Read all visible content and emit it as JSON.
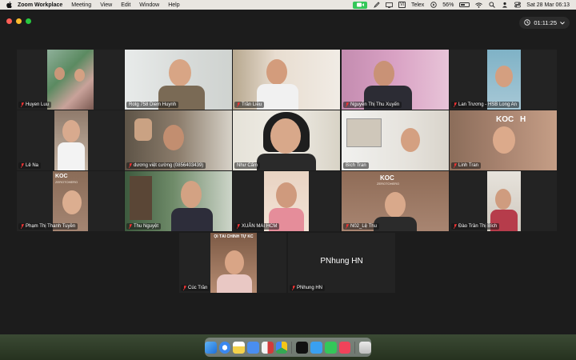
{
  "menubar": {
    "app_name": "Zoom Workplace",
    "items": [
      "Meeting",
      "View",
      "Edit",
      "Window",
      "Help"
    ],
    "input_source": "Telex",
    "battery": "56%",
    "battery_level": 0.56,
    "datetime": "Sat 28 Mar  06:13"
  },
  "meeting": {
    "timer": "01:11:25"
  },
  "participants": [
    {
      "name": "Huyen Luu"
    },
    {
      "name": "Rotg 758 Diem Huynh"
    },
    {
      "name": "Trần Liễu"
    },
    {
      "name": "Nguyễn Thị Thu Xuyến"
    },
    {
      "name": "Lan Trương  - HSB Long An"
    },
    {
      "name": "Lê Na"
    },
    {
      "name": "dương việt cường (0856403439)"
    },
    {
      "name": "Như Cẩm"
    },
    {
      "name": "Bích Tran"
    },
    {
      "name": "Linh Tran"
    },
    {
      "name": "Phạm Thị Thanh Tuyền"
    },
    {
      "name": "Thu Nguyệt"
    },
    {
      "name": "XUÂN MAI HCM"
    },
    {
      "name": "N02_Lệ Thu"
    },
    {
      "name": "Đào Trần Thị Bích"
    },
    {
      "name": "Cúc Trần"
    },
    {
      "name": "PNhung HN"
    }
  ],
  "tile_text": {
    "koc_title": "KOC",
    "koc_subtitle": "ZEROTOHERO",
    "koc_partial": "KOC",
    "koc_h": "H",
    "banner": "ỘI TÀI CHÍNH TỰ KC",
    "video_off_name": "PNhung HN"
  },
  "colors": {
    "active_speaker": "#3fd15a",
    "menubar_bg": "#e9e6e1",
    "window_bg": "#1c1c1c",
    "tile_bg": "#232323"
  }
}
